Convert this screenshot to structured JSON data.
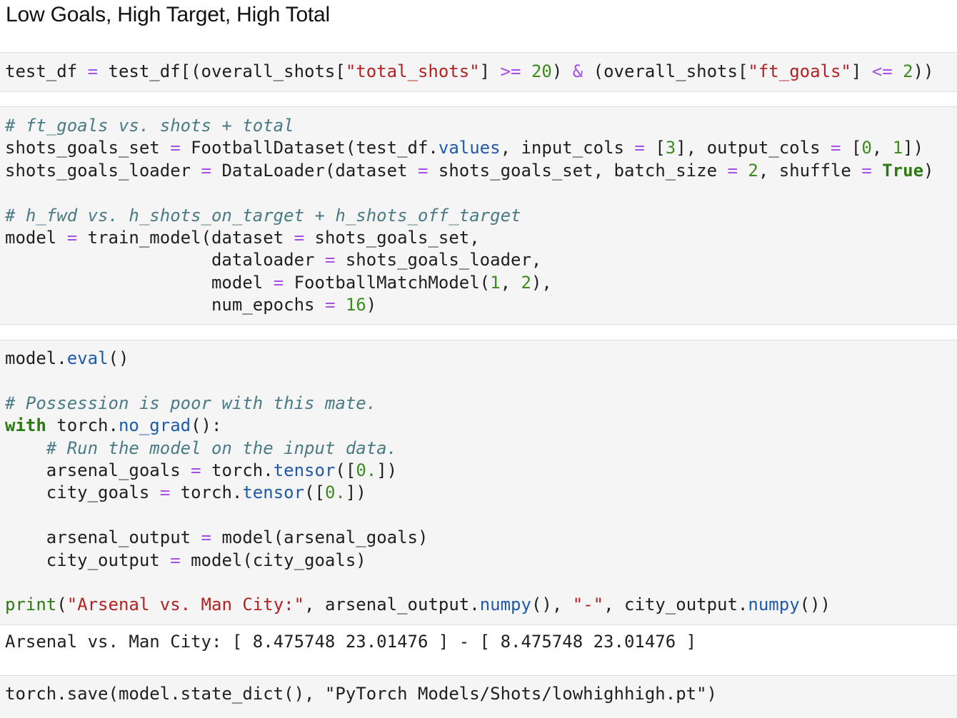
{
  "heading": "Low Goals, High Target, High Total",
  "cells": [
    {
      "lines": [
        [
          [
            "t",
            "test_df "
          ],
          [
            "o",
            "="
          ],
          [
            "t",
            " test_df[(overall_shots["
          ],
          [
            "s",
            "\"total_shots\""
          ],
          [
            "t",
            "] "
          ],
          [
            "o",
            ">="
          ],
          [
            "t",
            " "
          ],
          [
            "n",
            "20"
          ],
          [
            "t",
            ") "
          ],
          [
            "o",
            "&"
          ],
          [
            "t",
            " (overall_shots["
          ],
          [
            "s",
            "\"ft_goals\""
          ],
          [
            "t",
            "] "
          ],
          [
            "o",
            "<="
          ],
          [
            "t",
            " "
          ],
          [
            "n",
            "2"
          ],
          [
            "t",
            "))"
          ]
        ]
      ]
    },
    {
      "lines": [
        [
          [
            "c",
            "# ft_goals vs. shots + total"
          ]
        ],
        [
          [
            "t",
            "shots_goals_set "
          ],
          [
            "o",
            "="
          ],
          [
            "t",
            " FootballDataset(test_df."
          ],
          [
            "a",
            "values"
          ],
          [
            "t",
            ", input_cols "
          ],
          [
            "o",
            "="
          ],
          [
            "t",
            " ["
          ],
          [
            "n",
            "3"
          ],
          [
            "t",
            "], output_cols "
          ],
          [
            "o",
            "="
          ],
          [
            "t",
            " ["
          ],
          [
            "n",
            "0"
          ],
          [
            "t",
            ", "
          ],
          [
            "n",
            "1"
          ],
          [
            "t",
            "])"
          ]
        ],
        [
          [
            "t",
            "shots_goals_loader "
          ],
          [
            "o",
            "="
          ],
          [
            "t",
            " DataLoader(dataset "
          ],
          [
            "o",
            "="
          ],
          [
            "t",
            " shots_goals_set, batch_size "
          ],
          [
            "o",
            "="
          ],
          [
            "t",
            " "
          ],
          [
            "n",
            "2"
          ],
          [
            "t",
            ", shuffle "
          ],
          [
            "o",
            "="
          ],
          [
            "t",
            " "
          ],
          [
            "k",
            "True"
          ],
          [
            "t",
            ")"
          ]
        ],
        [
          [
            "t",
            ""
          ]
        ],
        [
          [
            "c",
            "# h_fwd vs. h_shots_on_target + h_shots_off_target"
          ]
        ],
        [
          [
            "t",
            "model "
          ],
          [
            "o",
            "="
          ],
          [
            "t",
            " train_model(dataset "
          ],
          [
            "o",
            "="
          ],
          [
            "t",
            " shots_goals_set,"
          ]
        ],
        [
          [
            "t",
            "                    dataloader "
          ],
          [
            "o",
            "="
          ],
          [
            "t",
            " shots_goals_loader,"
          ]
        ],
        [
          [
            "t",
            "                    model "
          ],
          [
            "o",
            "="
          ],
          [
            "t",
            " FootballMatchModel("
          ],
          [
            "n",
            "1"
          ],
          [
            "t",
            ", "
          ],
          [
            "n",
            "2"
          ],
          [
            "t",
            "),"
          ]
        ],
        [
          [
            "t",
            "                    num_epochs "
          ],
          [
            "o",
            "="
          ],
          [
            "t",
            " "
          ],
          [
            "n",
            "16"
          ],
          [
            "t",
            ")"
          ]
        ]
      ]
    },
    {
      "lines": [
        [
          [
            "t",
            "model."
          ],
          [
            "a",
            "eval"
          ],
          [
            "t",
            "()"
          ]
        ],
        [
          [
            "t",
            ""
          ]
        ],
        [
          [
            "c",
            "# Possession is poor with this mate."
          ]
        ],
        [
          [
            "k",
            "with"
          ],
          [
            "t",
            " torch."
          ],
          [
            "a",
            "no_grad"
          ],
          [
            "t",
            "():"
          ]
        ],
        [
          [
            "t",
            "    "
          ],
          [
            "c",
            "# Run the model on the input data."
          ]
        ],
        [
          [
            "t",
            "    arsenal_goals "
          ],
          [
            "o",
            "="
          ],
          [
            "t",
            " torch."
          ],
          [
            "a",
            "tensor"
          ],
          [
            "t",
            "(["
          ],
          [
            "n",
            "0."
          ],
          [
            "t",
            "])"
          ]
        ],
        [
          [
            "t",
            "    city_goals "
          ],
          [
            "o",
            "="
          ],
          [
            "t",
            " torch."
          ],
          [
            "a",
            "tensor"
          ],
          [
            "t",
            "(["
          ],
          [
            "n",
            "0."
          ],
          [
            "t",
            "])"
          ]
        ],
        [
          [
            "t",
            ""
          ]
        ],
        [
          [
            "t",
            "    arsenal_output "
          ],
          [
            "o",
            "="
          ],
          [
            "t",
            " model(arsenal_goals)"
          ]
        ],
        [
          [
            "t",
            "    city_output "
          ],
          [
            "o",
            "="
          ],
          [
            "t",
            " model(city_goals)"
          ]
        ],
        [
          [
            "t",
            ""
          ]
        ],
        [
          [
            "b",
            "print"
          ],
          [
            "t",
            "("
          ],
          [
            "s",
            "\"Arsenal vs. Man City:\""
          ],
          [
            "t",
            ", arsenal_output."
          ],
          [
            "a",
            "numpy"
          ],
          [
            "t",
            "(), "
          ],
          [
            "s",
            "\"-\""
          ],
          [
            "t",
            ", city_output."
          ],
          [
            "a",
            "numpy"
          ],
          [
            "t",
            "())"
          ]
        ]
      ],
      "output": "Arsenal vs. Man City: [ 8.475748 23.01476 ] - [ 8.475748 23.01476 ]"
    },
    {
      "lines": [
        [
          [
            "t",
            "torch.save(model.state_dict(), \"PyTorch Models/Shots/lowhighhigh.pt\")"
          ]
        ]
      ]
    }
  ],
  "colors": {
    "operator": "#a64ee8",
    "string": "#b22222",
    "number": "#3d8b1f",
    "comment": "#4a7b85",
    "keyword": "#2c7a12",
    "attribute": "#1f5aa8",
    "cell_background": "#f5f5f5"
  }
}
